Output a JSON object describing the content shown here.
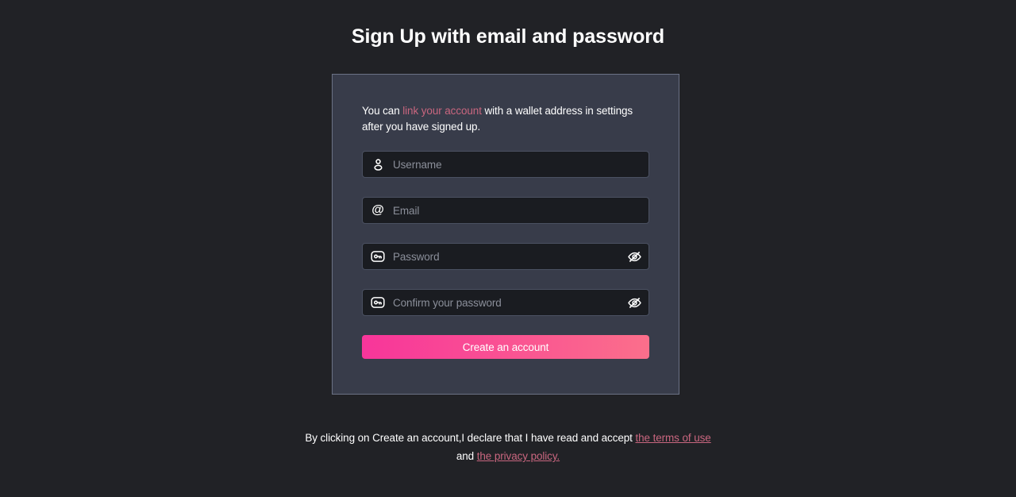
{
  "page": {
    "title": "Sign Up with email and password",
    "background_color": "#212226"
  },
  "card": {
    "background_color": "#383c4a",
    "border_color": "#6b7285",
    "note": {
      "before_link": "You can ",
      "link_label": "link your account",
      "after_link": " with a wallet address in settings after you have signed up.",
      "link_color": "#c9667f"
    },
    "fields": [
      {
        "name": "username",
        "icon": "user-icon",
        "placeholder": "Username",
        "value": "",
        "type": "text",
        "has_toggle": false
      },
      {
        "name": "email",
        "icon": "at-icon",
        "icon_glyph": "@",
        "placeholder": "Email",
        "value": "",
        "type": "email",
        "has_toggle": false
      },
      {
        "name": "password",
        "icon": "key-icon",
        "placeholder": "Password",
        "value": "",
        "type": "password",
        "has_toggle": true,
        "toggle_icon": "eye-off-icon"
      },
      {
        "name": "confirm-password",
        "icon": "key-icon",
        "placeholder": "Confirm your password",
        "value": "",
        "type": "password",
        "has_toggle": true,
        "toggle_icon": "eye-off-icon"
      }
    ],
    "submit": {
      "label": "Create an account",
      "gradient_start": "#f8359a",
      "gradient_end": "#fb6f8b"
    }
  },
  "footer": {
    "line1_text": "By clicking on Create an account,I declare that I have read and accept ",
    "terms_link": "the terms of use",
    "line2_and": "and ",
    "privacy_link": "the privacy policy.",
    "link_color": "#c9667f"
  }
}
